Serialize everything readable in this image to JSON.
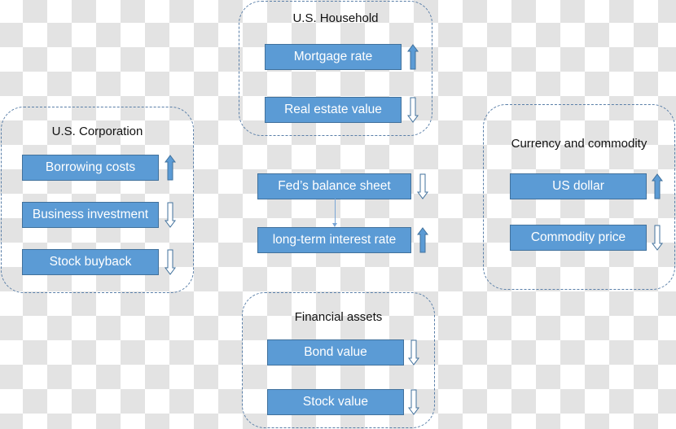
{
  "colors": {
    "box": "#5b9bd5",
    "arrow_up_fill": "#5b9bd5",
    "arrow_down_outline": "#41719c"
  },
  "panels": [
    {
      "id": "household",
      "title": "U.S. Household",
      "items": [
        {
          "label": "Mortgage rate",
          "direction": "up"
        },
        {
          "label": "Real estate value",
          "direction": "down"
        }
      ]
    },
    {
      "id": "corporation",
      "title": "U.S. Corporation",
      "items": [
        {
          "label": "Borrowing costs",
          "direction": "up"
        },
        {
          "label": "Business investment",
          "direction": "down"
        },
        {
          "label": "Stock buyback",
          "direction": "down"
        }
      ]
    },
    {
      "id": "currency",
      "title": "Currency and commodity",
      "items": [
        {
          "label": "US dollar",
          "direction": "up"
        },
        {
          "label": "Commodity price",
          "direction": "down"
        }
      ]
    },
    {
      "id": "financial",
      "title": "Financial assets",
      "items": [
        {
          "label": "Bond value",
          "direction": "down"
        },
        {
          "label": "Stock value",
          "direction": "down"
        }
      ]
    }
  ],
  "center": {
    "items": [
      {
        "label": "Fed’s balance sheet",
        "direction": "down"
      },
      {
        "label": "long-term interest rate",
        "direction": "up"
      }
    ]
  }
}
